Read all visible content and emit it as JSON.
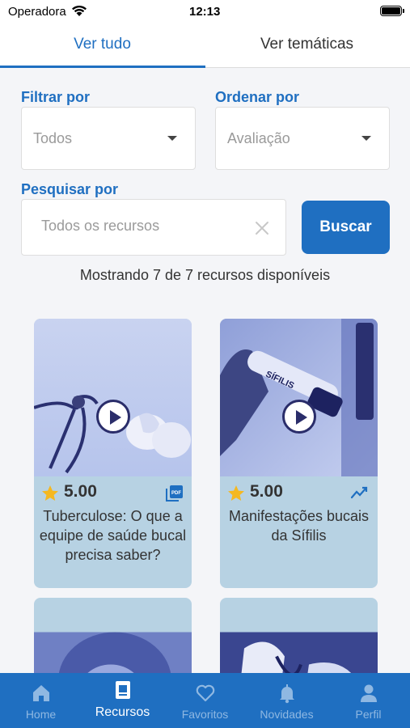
{
  "status_bar": {
    "carrier": "Operadora",
    "time": "12:13"
  },
  "tabs": [
    {
      "label": "Ver tudo",
      "active": true
    },
    {
      "label": "Ver temáticas",
      "active": false
    }
  ],
  "filters": {
    "filter_label": "Filtrar por",
    "filter_value": "Todos",
    "order_label": "Ordenar por",
    "order_value": "Avaliação",
    "search_label": "Pesquisar por",
    "search_placeholder": "Todos os recursos",
    "search_value": "",
    "search_button": "Buscar"
  },
  "results_text": "Mostrando 7 de 7 recursos disponíveis",
  "cards": [
    {
      "rating": "5.00",
      "title": "Tuberculose: O que a equipe de saúde bucal precisa saber?",
      "type_icon": "pdf-icon"
    },
    {
      "rating": "5.00",
      "title": "Manifestações bucais da Sífilis",
      "type_icon": "trending-icon"
    }
  ],
  "card_image_text": "SÍFILIS",
  "bottom_nav": [
    {
      "label": "Home",
      "icon": "home-icon",
      "active": false
    },
    {
      "label": "Recursos",
      "icon": "resources-icon",
      "active": true
    },
    {
      "label": "Favoritos",
      "icon": "heart-icon",
      "active": false
    },
    {
      "label": "Novidades",
      "icon": "bell-icon",
      "active": false
    },
    {
      "label": "Perfil",
      "icon": "person-icon",
      "active": false
    }
  ],
  "colors": {
    "primary": "#1f6fc1",
    "card_bg": "#b7d2e3",
    "star": "#f5b820"
  }
}
